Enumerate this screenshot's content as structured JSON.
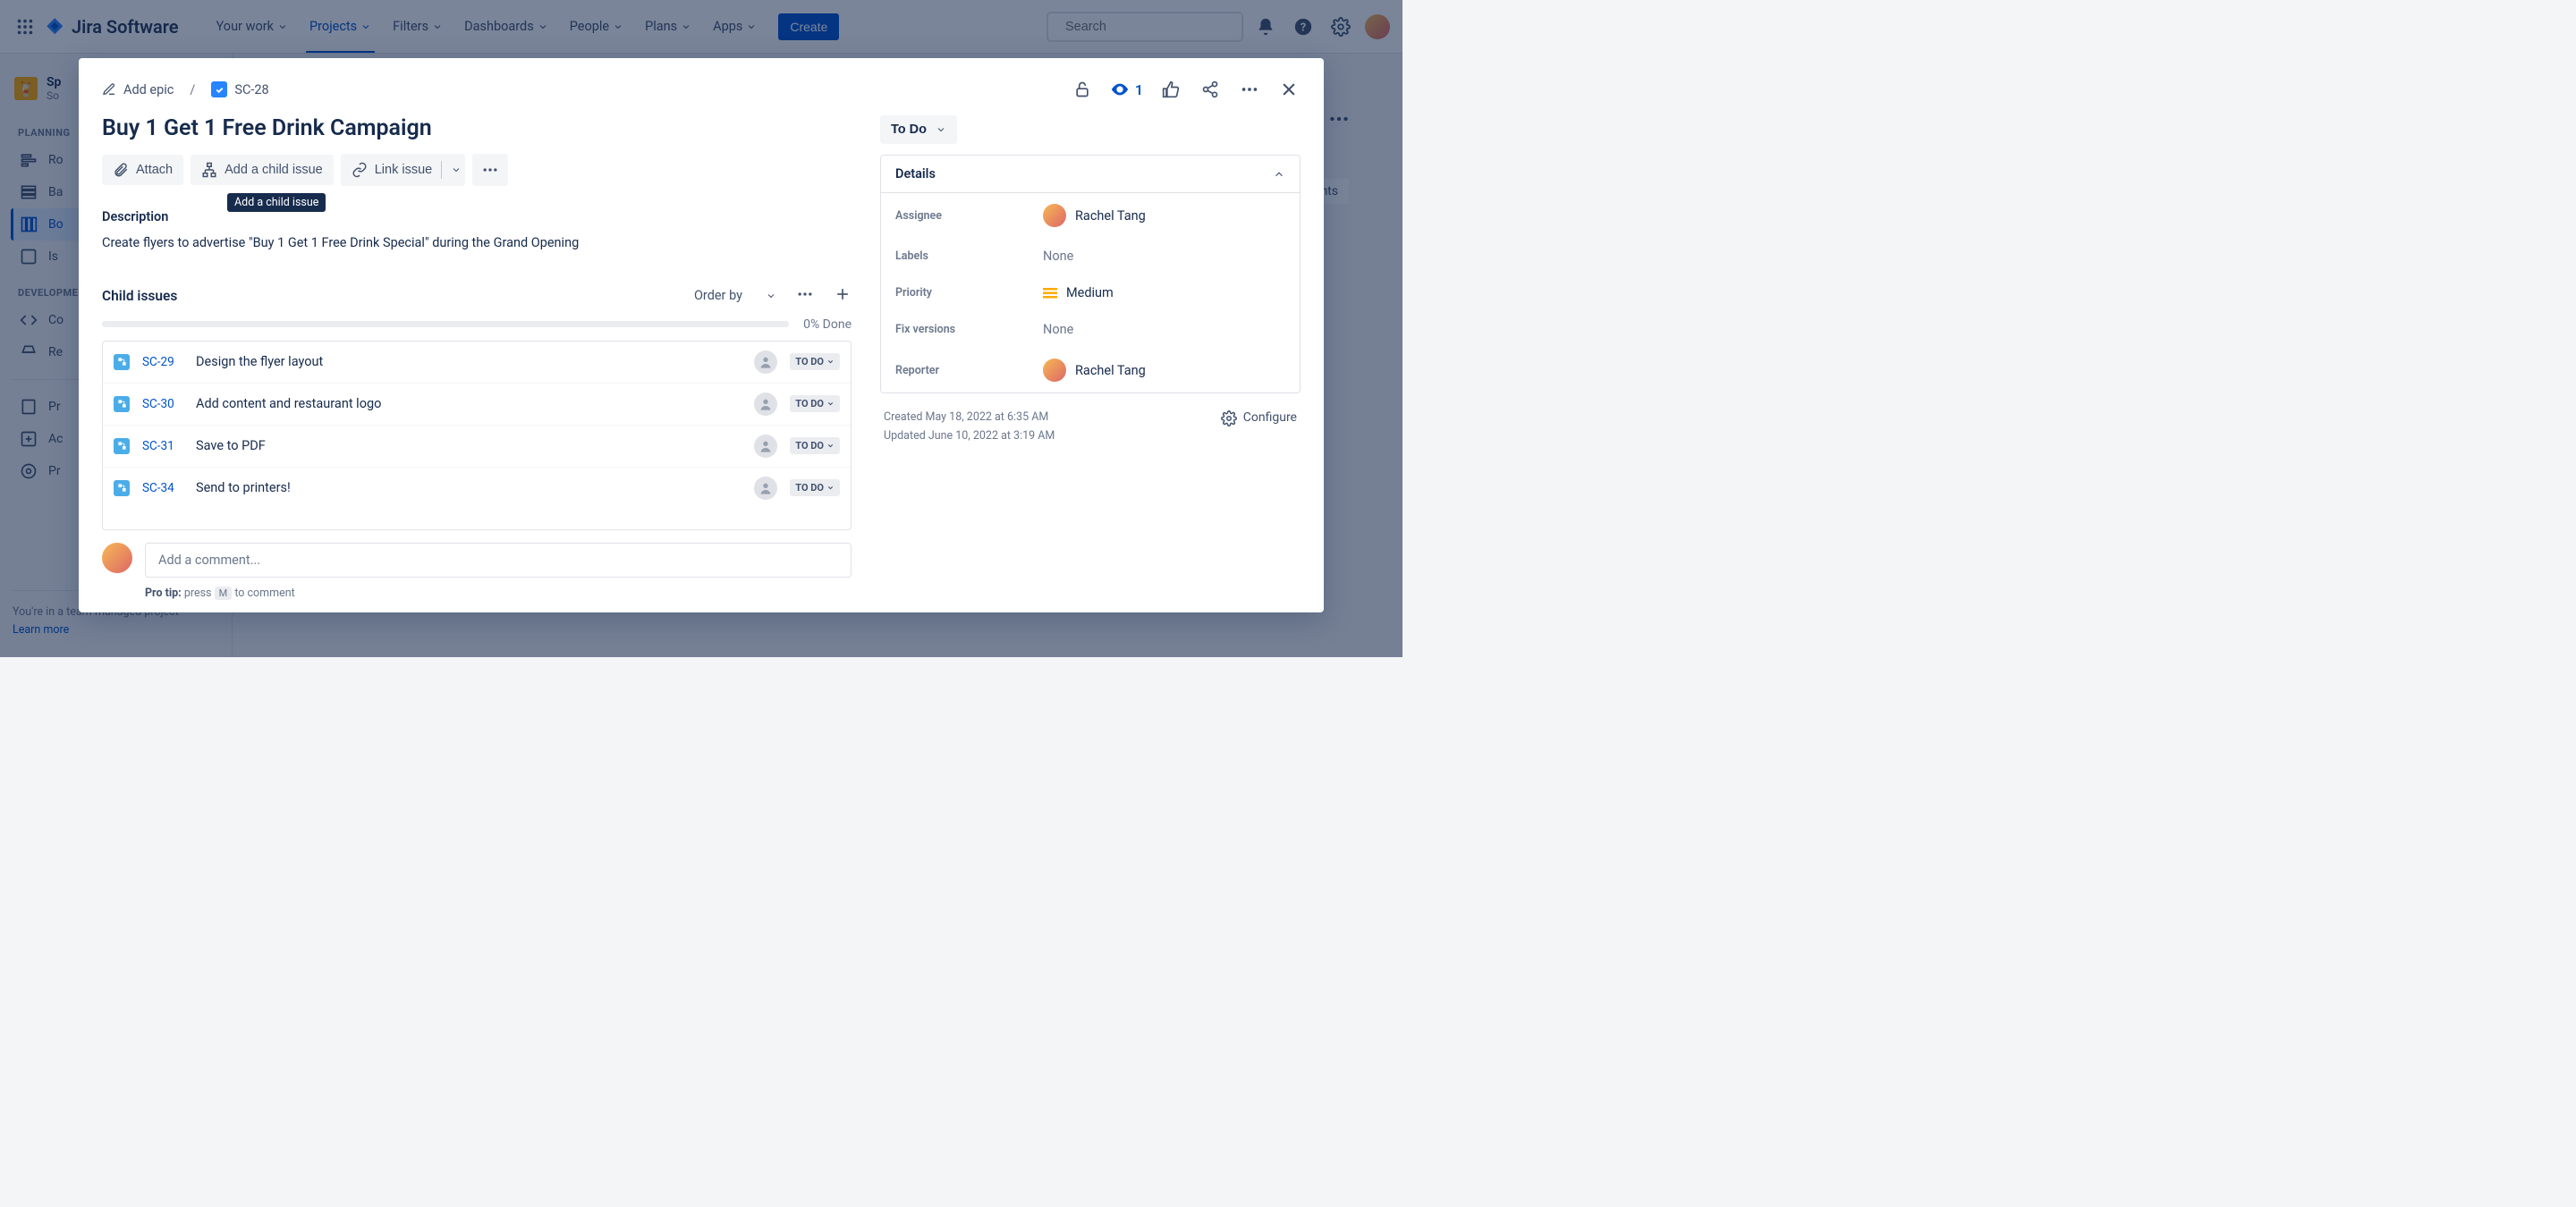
{
  "topnav": {
    "logo": "Jira Software",
    "items": [
      "Your work",
      "Projects",
      "Filters",
      "Dashboards",
      "People",
      "Plans",
      "Apps"
    ],
    "active_index": 1,
    "create": "Create",
    "search_placeholder": "Search"
  },
  "sidebar": {
    "project_name_short": "Sp",
    "project_sub": "So",
    "planning_label": "PLANNING",
    "planning_items": [
      "Ro",
      "Ba",
      "Bo",
      "Is"
    ],
    "planning_selected": 2,
    "dev_label": "DEVELOPME",
    "dev_items": [
      "Co",
      "Re"
    ],
    "other_items": [
      "Pr",
      "Ac",
      "Pr"
    ],
    "footer_line": "You're in a team-managed project",
    "footer_link": "Learn more"
  },
  "peek": {
    "insights": "sights"
  },
  "modal": {
    "breadcrumb": {
      "add_epic": "Add epic",
      "key": "SC-28"
    },
    "title": "Buy 1 Get 1 Free Drink Campaign",
    "toolbar": {
      "attach": "Attach",
      "add_child": "Add a child issue",
      "link": "Link issue",
      "tooltip": "Add a child issue"
    },
    "description_label": "Description",
    "description": "Create flyers to advertise \"Buy 1 Get 1 Free Drink Special\" during the Grand Opening",
    "child_label": "Child issues",
    "order_by": "Order by",
    "progress_done": "0% Done",
    "children": [
      {
        "key": "SC-29",
        "summary": "Design the flyer layout",
        "status": "TO DO"
      },
      {
        "key": "SC-30",
        "summary": "Add content and restaurant logo",
        "status": "TO DO"
      },
      {
        "key": "SC-31",
        "summary": "Save to PDF",
        "status": "TO DO"
      },
      {
        "key": "SC-34",
        "summary": "Send to printers!",
        "status": "TO DO"
      }
    ],
    "comment_placeholder": "Add a comment...",
    "protip_label": "Pro tip:",
    "protip_press": "press",
    "protip_key": "M",
    "protip_tail": "to comment",
    "watch_count": "1"
  },
  "status": {
    "current": "To Do"
  },
  "details": {
    "title": "Details",
    "assignee_label": "Assignee",
    "assignee": "Rachel Tang",
    "labels_label": "Labels",
    "labels": "None",
    "priority_label": "Priority",
    "priority": "Medium",
    "fixv_label": "Fix versions",
    "fixv": "None",
    "reporter_label": "Reporter",
    "reporter": "Rachel Tang"
  },
  "dates": {
    "created": "Created May 18, 2022 at 6:35 AM",
    "updated": "Updated June 10, 2022 at 3:19 AM",
    "configure": "Configure"
  }
}
